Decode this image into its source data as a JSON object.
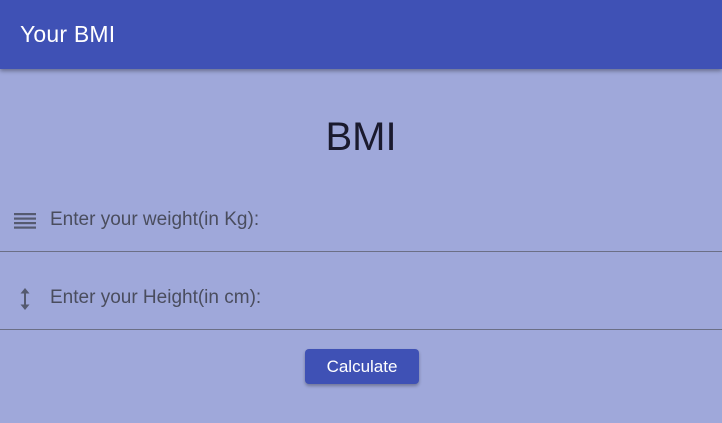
{
  "appbar": {
    "title": "Your BMI",
    "color": "#3f51b5"
  },
  "main": {
    "title": "BMI",
    "background": "#9fa8da"
  },
  "form": {
    "weight": {
      "icon": "lines-icon",
      "placeholder": "Enter your weight(in Kg):",
      "value": ""
    },
    "height": {
      "icon": "vertical-arrows-icon",
      "placeholder": "Enter your Height(in cm):",
      "value": ""
    },
    "calculate_label": "Calculate"
  }
}
